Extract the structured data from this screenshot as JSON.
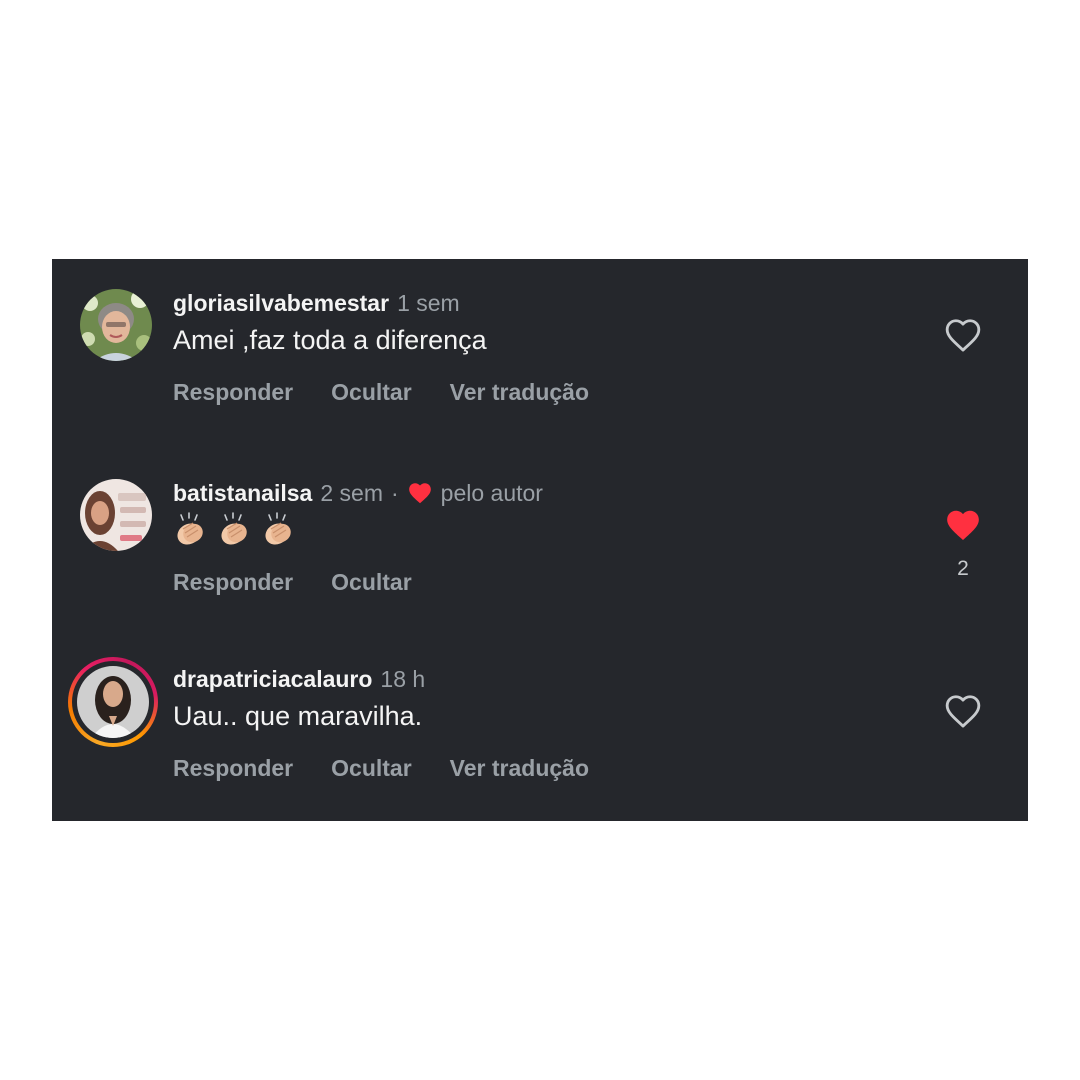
{
  "comments": [
    {
      "username": "gloriasilvabemestar",
      "time": "1 sem",
      "text": "Amei ,faz toda a diferença",
      "actions": [
        "Responder",
        "Ocultar",
        "Ver tradução"
      ],
      "liked": false
    },
    {
      "username": "batistanailsa",
      "time": "2 sem",
      "separator": "·",
      "author_like_label": "pelo autor",
      "text_emojis": [
        "clapping-hands",
        "clapping-hands",
        "clapping-hands"
      ],
      "actions": [
        "Responder",
        "Ocultar"
      ],
      "liked": true,
      "like_count": "2"
    },
    {
      "username": "drapatriciacalauro",
      "time": "18 h",
      "text": "Uau.. que maravilha.",
      "actions": [
        "Responder",
        "Ocultar",
        "Ver tradução"
      ],
      "liked": false,
      "has_story_ring": true
    }
  ],
  "colors": {
    "panel_bg": "#25272c",
    "text_primary": "#f4f4f4",
    "text_secondary": "#9aa0a6",
    "heart_red": "#ff3040"
  },
  "icons": {
    "like_outline": "heart-outline-icon",
    "like_filled": "heart-filled-icon"
  }
}
